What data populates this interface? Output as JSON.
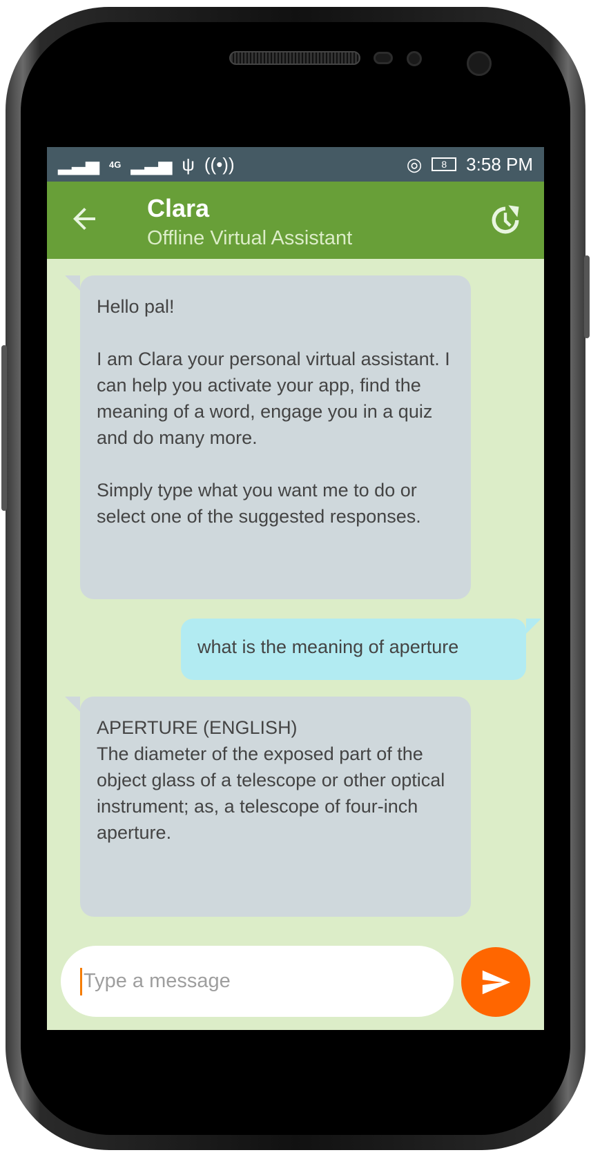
{
  "status_bar": {
    "network": "4G",
    "battery": "8",
    "time": "3:58 PM"
  },
  "app_bar": {
    "title": "Clara",
    "subtitle": "Offline Virtual Assistant",
    "back_icon": "arrow-left-icon",
    "history_icon": "history-icon"
  },
  "messages": [
    {
      "from": "bot",
      "text": "Hello pal!\n\nI am Clara your personal virtual assistant. I can help you activate your app, find the meaning of a word, engage you in a quiz and do many more.\n\nSimply type what you want me to do or select one of the suggested responses."
    },
    {
      "from": "user",
      "text": "what is the meaning of aperture"
    },
    {
      "from": "bot",
      "text": "APERTURE (ENGLISH)\nThe diameter of the exposed part of the object glass of a telescope or other optical instrument; as, a telescope of four-inch aperture.\n\n"
    }
  ],
  "composer": {
    "placeholder": "Type a message",
    "send_icon": "send-icon"
  },
  "colors": {
    "status_bar": "#455a64",
    "app_bar": "#689f38",
    "background": "#dcedc8",
    "bot_bubble": "#cfd8dc",
    "user_bubble": "#b2ebf2",
    "send": "#ff6600"
  }
}
